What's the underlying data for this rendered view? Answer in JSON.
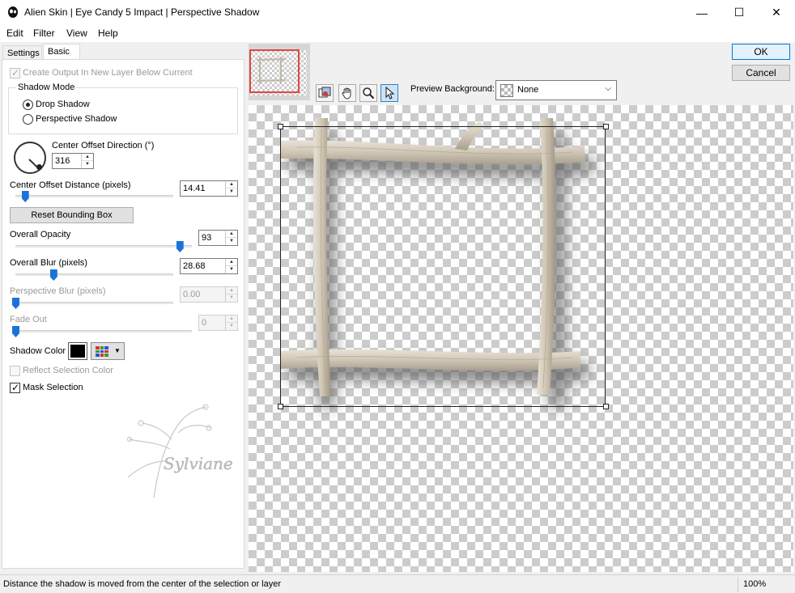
{
  "window": {
    "title": "Alien Skin | Eye Candy 5 Impact | Perspective Shadow",
    "min_glyph": "—",
    "max_glyph": "☐",
    "close_glyph": "✕"
  },
  "menu": [
    "Edit",
    "Filter",
    "View",
    "Help"
  ],
  "tabs": {
    "settings": "Settings",
    "basic": "Basic"
  },
  "basic": {
    "create_output": {
      "label": "Create Output In New Layer Below Current",
      "checked": true,
      "enabled": false
    },
    "shadow_mode": {
      "title": "Shadow Mode",
      "drop": "Drop Shadow",
      "perspective": "Perspective Shadow",
      "selected": "Drop Shadow"
    },
    "direction": {
      "label": "Center Offset Direction (°)",
      "value": "316"
    },
    "distance": {
      "label": "Center Offset Distance (pixels)",
      "value": "14.41",
      "fraction": 0.06
    },
    "reset_button": "Reset Bounding Box",
    "opacity": {
      "label": "Overall Opacity",
      "value": "93",
      "fraction": 0.93
    },
    "blur": {
      "label": "Overall Blur (pixels)",
      "value": "28.68",
      "fraction": 0.24
    },
    "perspective_blur": {
      "label": "Perspective Blur (pixels)",
      "value": "0.00",
      "fraction": 0.0,
      "enabled": false
    },
    "fade_out": {
      "label": "Fade Out",
      "value": "0",
      "fraction": 0.0,
      "enabled": false
    },
    "shadow_color": {
      "label": "Shadow Color",
      "color": "#000000"
    },
    "reflect_selection": {
      "label": "Reflect Selection Color",
      "checked": false,
      "enabled": false
    },
    "mask_selection": {
      "label": "Mask Selection",
      "checked": true
    }
  },
  "buttons": {
    "ok": "OK",
    "cancel": "Cancel"
  },
  "toolbar": {
    "tools": [
      "preview-toggle-icon",
      "hand-icon",
      "zoom-icon",
      "arrow-pointer-icon"
    ],
    "preview_bg_label": "Preview Background:",
    "preview_bg_value": "None"
  },
  "watermark_text": "Sylviane",
  "status": {
    "hint": "Distance the shadow is moved from the center of the selection or layer",
    "zoom": "100%"
  },
  "colors": {
    "accent": "#1a73d9",
    "ok_border": "#0078d7",
    "thumb_border": "#e04545"
  }
}
